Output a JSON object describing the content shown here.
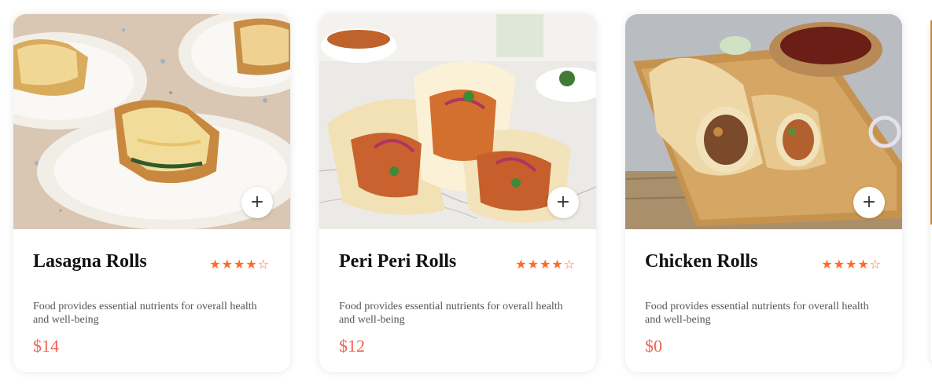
{
  "products": [
    {
      "name": "Lasagna Rolls",
      "rating": 4,
      "max_rating": 5,
      "description": "Food provides essential nutrients for overall health and well-being",
      "price": "$14",
      "image_icon": "lasagna-rolls-photo",
      "add_label": "+"
    },
    {
      "name": "Peri Peri Rolls",
      "rating": 4,
      "max_rating": 5,
      "description": "Food provides essential nutrients for overall health and well-being",
      "price": "$12",
      "image_icon": "peri-peri-rolls-photo",
      "add_label": "+"
    },
    {
      "name": "Chicken Rolls",
      "rating": 4,
      "max_rating": 5,
      "description": "Food provides essential nutrients for overall health and well-being",
      "price": "$0",
      "image_icon": "chicken-rolls-photo",
      "add_label": "+"
    }
  ],
  "colors": {
    "star": "#ff6a2b",
    "price": "#f0634d",
    "title": "#111111",
    "description": "#555555"
  }
}
